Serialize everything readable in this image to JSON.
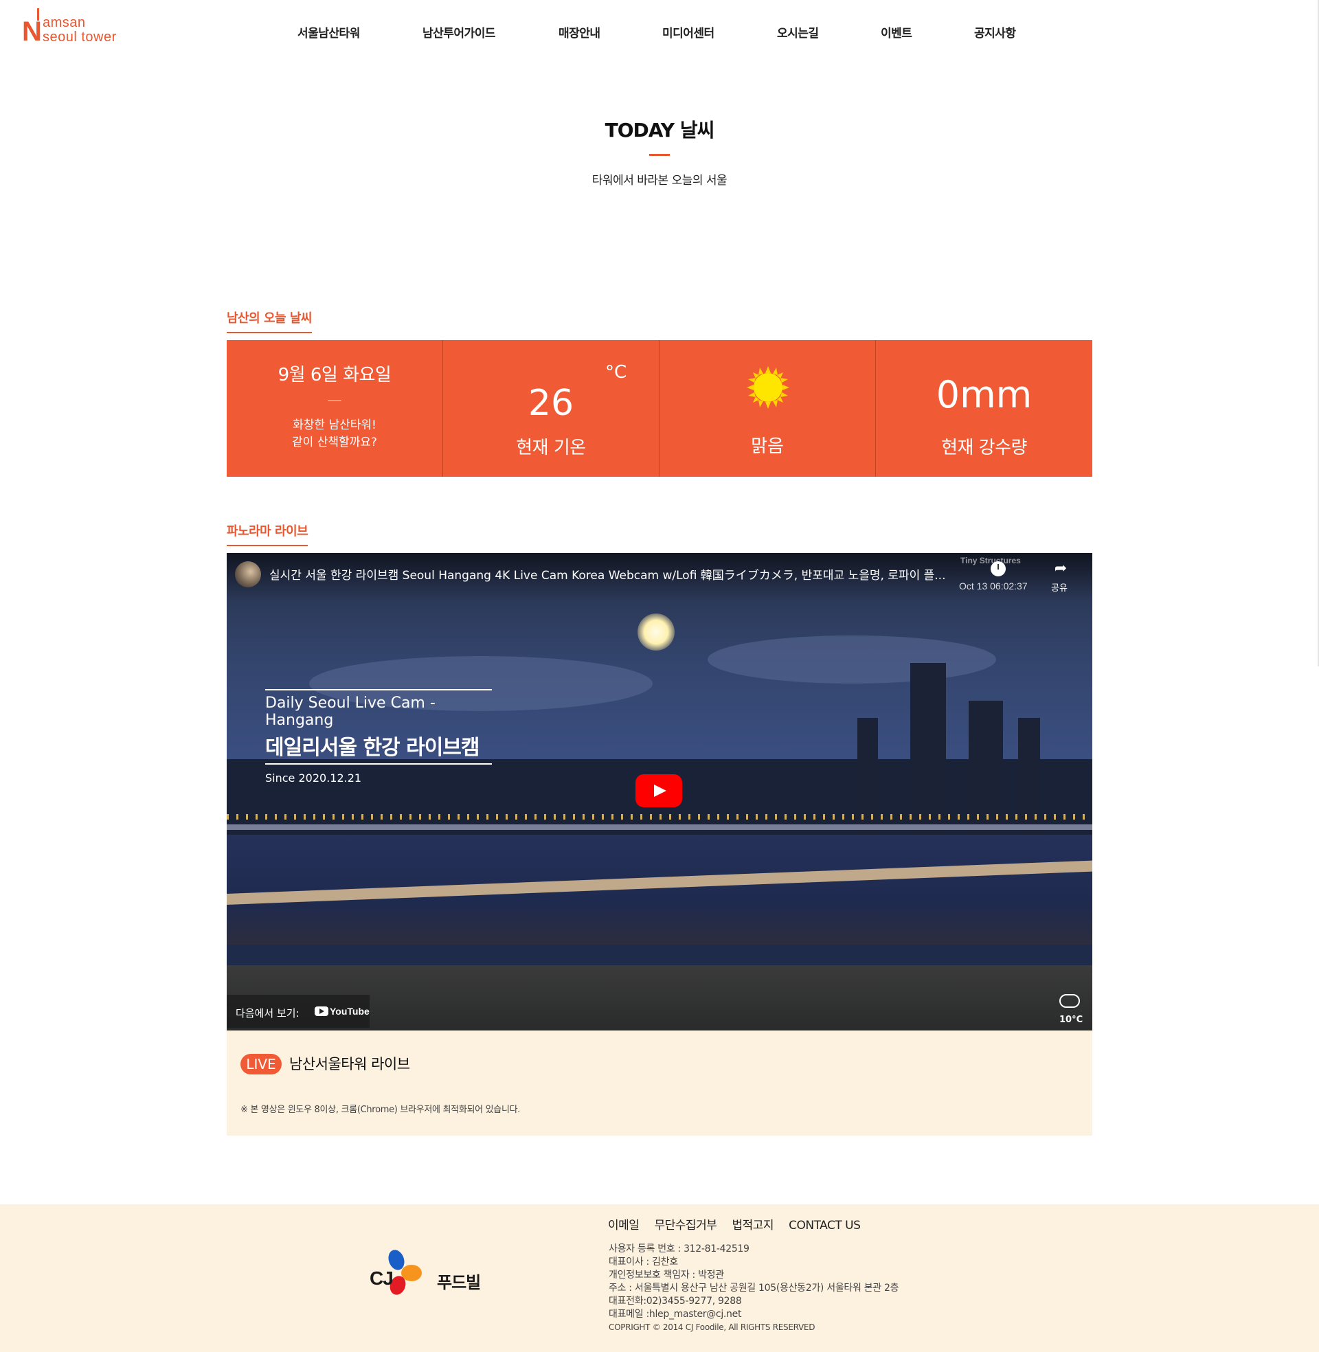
{
  "header": {
    "logo_line1": "amsan",
    "logo_line2": "seoul tower",
    "logo_letter": "N",
    "nav": [
      {
        "label": "서울남산타워"
      },
      {
        "label": "남산투어가이드"
      },
      {
        "label": "매장안내"
      },
      {
        "label": "미디어센터"
      },
      {
        "label": "오시는길"
      },
      {
        "label": "이벤트"
      },
      {
        "label": "공지사항"
      }
    ]
  },
  "intro": {
    "title": "TODAY 날씨",
    "subtitle": "타워에서 바라본 오늘의 서울"
  },
  "weather": {
    "heading": "남산의 오늘 날씨",
    "date": "9월 6일 화요일",
    "message_line1": "화창한 남산타워!",
    "message_line2": "같이 산책할까요?",
    "temperature": "26",
    "temperature_unit": "°C",
    "temperature_label": "현재 기온",
    "condition": "맑음",
    "condition_icon": "sun-icon",
    "rainfall": "0mm",
    "rainfall_label": "현재 강수량",
    "accent_color": "#f05a35"
  },
  "panorama": {
    "heading": "파노라마 라이브",
    "video": {
      "title": "실시간 서울 한강 라이브캠 Seoul Hangang 4K Live Cam Korea Webcam w/Lofi 韓国ライブカメラ, 반포대교 노을명, 로파이 플...",
      "channel_watermark": "Tiny Structures",
      "timestamp": "Oct 13 06:02:37",
      "share_label": "공유",
      "overlay_line1": "Daily Seoul Live Cam - Hangang",
      "overlay_line2": "데일리서울 한강 라이브캠",
      "overlay_line3": "Since 2020.12.21",
      "watch_on": "다음에서 보기:",
      "youtube_label": "YouTube",
      "weather_temp": "10°C"
    },
    "live_badge": "LIVE",
    "live_title": "남산서울타워 라이브",
    "note": "※ 본 영상은 윈도우 8이상, 크롬(Chrome) 브라우저에 최적화되어 있습니다."
  },
  "footer": {
    "brand_text": "CJ",
    "brand_name": "푸드빌",
    "links": [
      {
        "label": "이메일"
      },
      {
        "label": "무단수집거부"
      },
      {
        "label": "법적고지"
      },
      {
        "label": "CONTACT US"
      }
    ],
    "info": [
      "사용자 등록 번호 : 312-81-42519",
      "대표이사 : 김찬호",
      "개인정보보호 책임자 : 박정관",
      "주소 : 서울특별시 용산구 남산 공원길 105(용산동2가) 서울타워 본관 2층",
      "대표전화:02)3455-9277, 9288",
      "대표메일 :hlep_master@cj.net"
    ],
    "copyright": "COPRIGHT © 2014 CJ Foodile, All RIGHTS RESERVED"
  }
}
